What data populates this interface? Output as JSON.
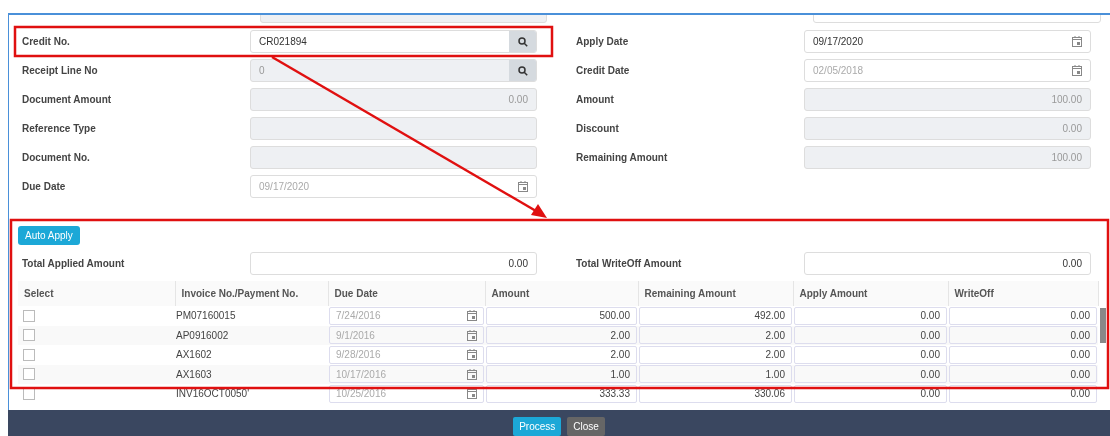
{
  "form": {
    "left": [
      {
        "label": "Credit No.",
        "value": "CR021894",
        "kind": "lookup",
        "disabled": false
      },
      {
        "label": "Receipt Line No",
        "value": "0",
        "kind": "lookup",
        "disabled": true
      },
      {
        "label": "Document Amount",
        "value": "0.00",
        "kind": "number",
        "disabled": true
      },
      {
        "label": "Reference Type",
        "kind": "text",
        "disabled": true
      },
      {
        "label": "Document No.",
        "kind": "text",
        "disabled": true
      },
      {
        "label": "Due Date",
        "value": "09/17/2020",
        "kind": "date",
        "disabled": true
      }
    ],
    "right": [
      {
        "label": "Apply Date",
        "value": "09/17/2020",
        "kind": "date",
        "disabled": false
      },
      {
        "label": "Credit Date",
        "value": "02/05/2018",
        "kind": "date",
        "disabled": true
      },
      {
        "label": "Amount",
        "value": "100.00",
        "kind": "number",
        "disabled": true
      },
      {
        "label": "Discount",
        "value": "0.00",
        "kind": "number",
        "disabled": true
      },
      {
        "label": "Remaining Amount",
        "value": "100.00",
        "kind": "number",
        "disabled": true
      }
    ]
  },
  "auto_apply_button": "Auto Apply",
  "totals": [
    {
      "label": "Total Applied Amount",
      "value": "0.00"
    },
    {
      "label": "Total WriteOff Amount",
      "value": "0.00"
    }
  ],
  "table": {
    "columns": [
      "Select",
      "Invoice No./Payment No.",
      "Due Date",
      "Amount",
      "Remaining Amount",
      "Apply Amount",
      "WriteOff"
    ],
    "rows": [
      {
        "checked": false,
        "invoice": "PM07160015",
        "due_date": "7/24/2016",
        "amount": "500.00",
        "remaining_amount": "492.00",
        "apply_amount": "0.00",
        "writeoff": "0.00"
      },
      {
        "checked": false,
        "invoice": "AP0916002",
        "due_date": "9/1/2016",
        "amount": "2.00",
        "remaining_amount": "2.00",
        "apply_amount": "0.00",
        "writeoff": "0.00"
      },
      {
        "checked": false,
        "invoice": "AX1602",
        "due_date": "9/28/2016",
        "amount": "2.00",
        "remaining_amount": "2.00",
        "apply_amount": "0.00",
        "writeoff": "0.00"
      },
      {
        "checked": false,
        "invoice": "AX1603",
        "due_date": "10/17/2016",
        "amount": "1.00",
        "remaining_amount": "1.00",
        "apply_amount": "0.00",
        "writeoff": "0.00"
      },
      {
        "checked": false,
        "invoice": "INV16OCT0050'",
        "due_date": "10/25/2016",
        "amount": "333.33",
        "remaining_amount": "330.06",
        "apply_amount": "0.00",
        "writeoff": "0.00"
      }
    ]
  },
  "footer_buttons": [
    {
      "label": "Process",
      "kind": "primary"
    },
    {
      "label": "Close",
      "kind": "secondary"
    }
  ]
}
